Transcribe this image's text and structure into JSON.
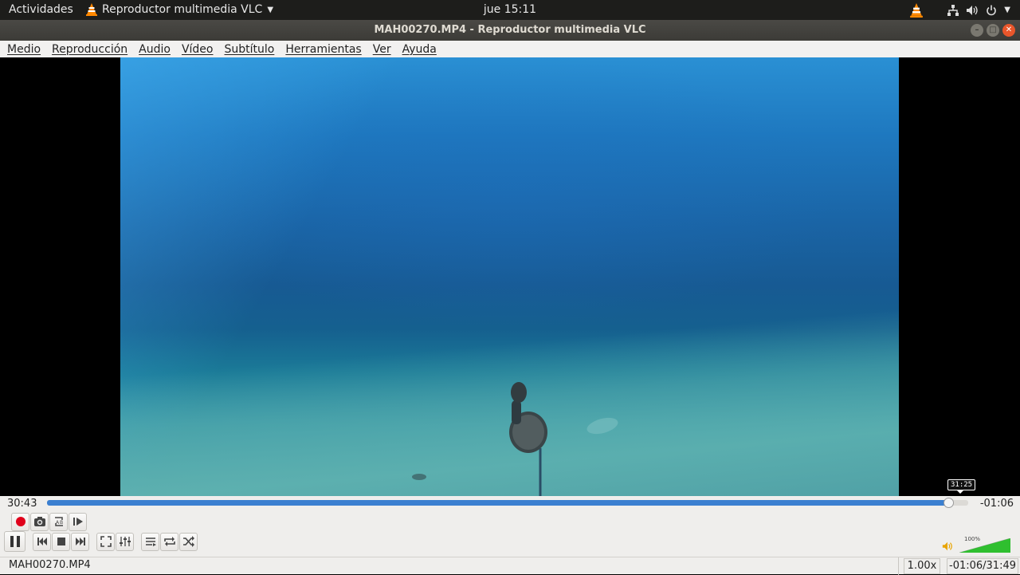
{
  "topbar": {
    "activities": "Actividades",
    "app_menu": "Reproductor multimedia VLC",
    "clock": "jue 15:11"
  },
  "window": {
    "title": "MAH00270.MP4 - Reproductor multimedia VLC"
  },
  "menu": {
    "items": [
      "Medio",
      "Reproducción",
      "Audio",
      "Vídeo",
      "Subtítulo",
      "Herramientas",
      "Ver",
      "Ayuda"
    ]
  },
  "playback": {
    "elapsed": "30:43",
    "remaining": "-01:06",
    "hover_time": "31:25",
    "progress": 0.978,
    "volume_label": "100%",
    "volume": 1.0
  },
  "status": {
    "filename": "MAH00270.MP4",
    "speed": "1.00x",
    "time": "-01:06/31:49"
  },
  "icons": {
    "record": "record-icon",
    "snapshot": "camera-icon",
    "loop_ab": "loop-ab-icon",
    "frame_step": "frame-step-icon",
    "pause": "pause-icon",
    "previous": "previous-icon",
    "stop": "stop-icon",
    "next": "next-icon",
    "fullscreen": "fullscreen-icon",
    "extended": "equalizer-icon",
    "playlist": "playlist-icon",
    "loop": "loop-icon",
    "shuffle": "shuffle-icon"
  },
  "colors": {
    "accent": "#3b7fd0",
    "record": "#e0001b",
    "volume": "#2fbf2f",
    "vlc_orange": "#ff8800"
  }
}
